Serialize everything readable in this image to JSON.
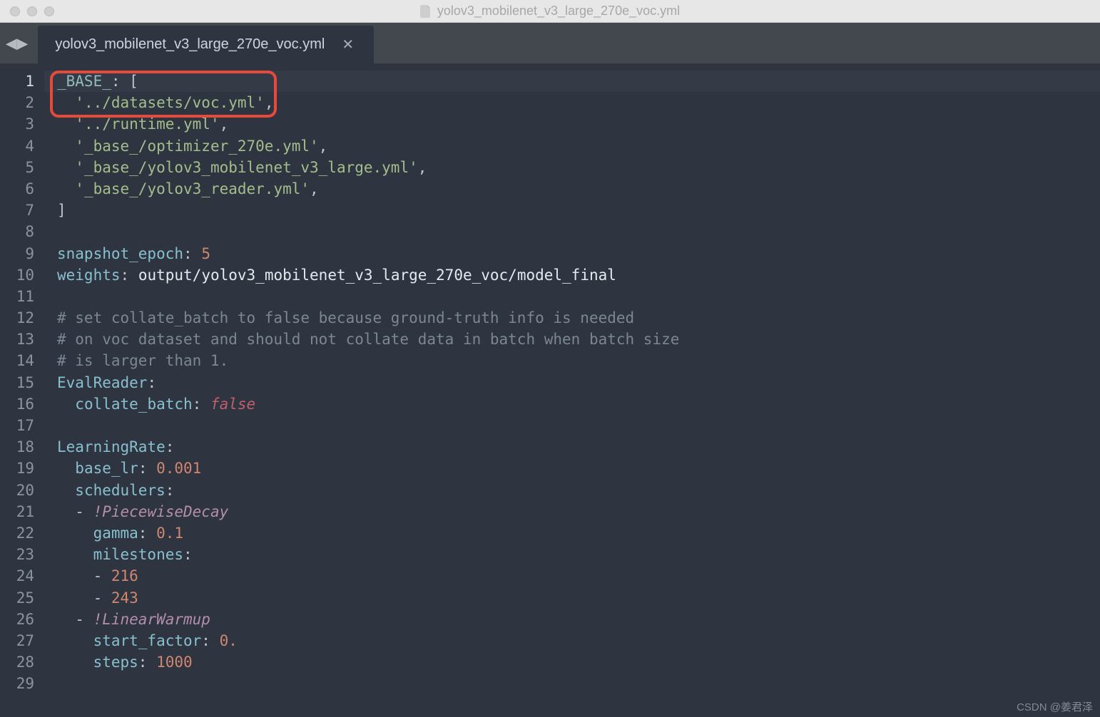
{
  "window": {
    "title": "yolov3_mobilenet_v3_large_270e_voc.yml"
  },
  "tab": {
    "name": "yolov3_mobilenet_v3_large_270e_voc.yml"
  },
  "code": {
    "l1_key": "_BASE_",
    "l2_str": "'../datasets/voc.yml'",
    "l3_str": "'../runtime.yml'",
    "l4_str": "'_base_/optimizer_270e.yml'",
    "l5_str": "'_base_/yolov3_mobilenet_v3_large.yml'",
    "l6_str": "'_base_/yolov3_reader.yml'",
    "l9_key": "snapshot_epoch",
    "l9_val": "5",
    "l10_key": "weights",
    "l10_val": "output/yolov3_mobilenet_v3_large_270e_voc/model_final",
    "l12_c": "# set collate_batch to false because ground-truth info is needed",
    "l13_c": "# on voc dataset and should not collate data in batch when batch size",
    "l14_c": "# is larger than 1.",
    "l15_key": "EvalReader",
    "l16_key": "collate_batch",
    "l16_val": "false",
    "l18_key": "LearningRate",
    "l19_key": "base_lr",
    "l19_val": "0.001",
    "l20_key": "schedulers",
    "l21_tag": "!PiecewiseDecay",
    "l22_key": "gamma",
    "l22_val": "0.1",
    "l23_key": "milestones",
    "l24_val": "216",
    "l25_val": "243",
    "l26_tag": "!LinearWarmup",
    "l27_key": "start_factor",
    "l27_val": "0.",
    "l28_key": "steps",
    "l28_val": "1000"
  },
  "line_numbers": [
    "1",
    "2",
    "3",
    "4",
    "5",
    "6",
    "7",
    "8",
    "9",
    "10",
    "11",
    "12",
    "13",
    "14",
    "15",
    "16",
    "17",
    "18",
    "19",
    "20",
    "21",
    "22",
    "23",
    "24",
    "25",
    "26",
    "27",
    "28",
    "29"
  ],
  "watermark": "CSDN @姜君泽"
}
